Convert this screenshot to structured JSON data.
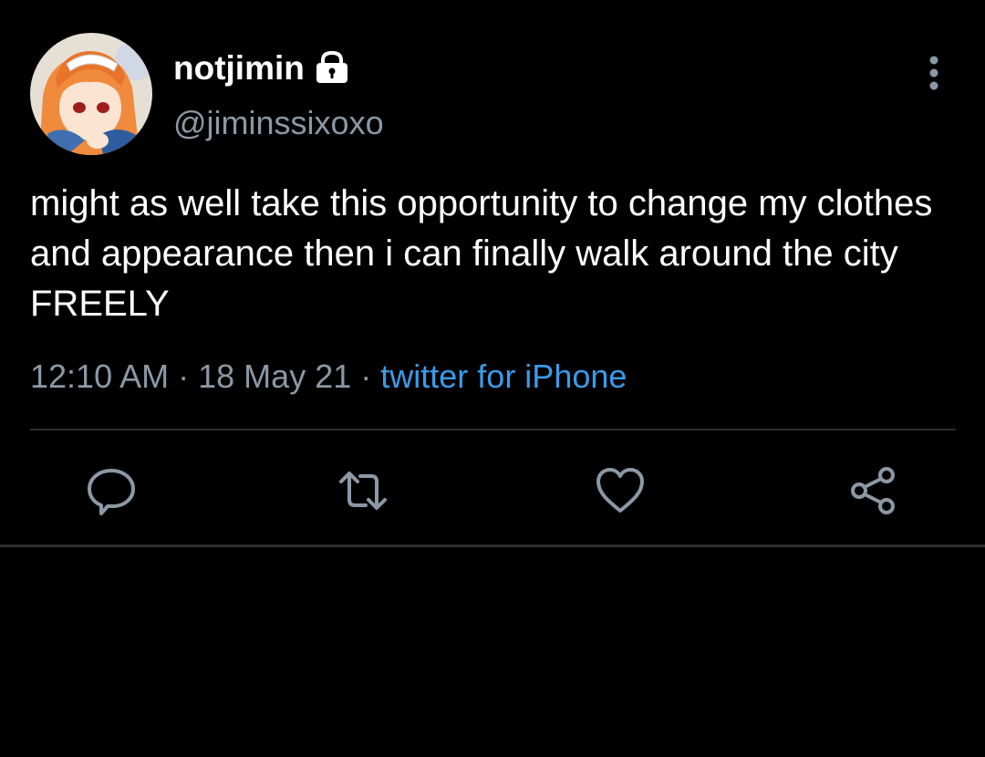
{
  "tweet": {
    "display_name": "notjimin",
    "handle": "@jiminssixoxo",
    "text": "might as well take this opportunity to change my clothes and appearance then i can finally walk around the city FREELY",
    "time": "12:10 AM",
    "separator": "·",
    "date": "18 May 21",
    "source": "twitter for iPhone"
  },
  "icons": {
    "lock": "lock-icon",
    "more": "more-vertical-icon",
    "reply": "reply-icon",
    "retweet": "retweet-icon",
    "like": "heart-icon",
    "share": "share-icon"
  },
  "colors": {
    "background": "#000000",
    "text": "#ffffff",
    "secondary": "#8b98a5",
    "link": "#3a9be8",
    "divider": "#2a2e33"
  }
}
